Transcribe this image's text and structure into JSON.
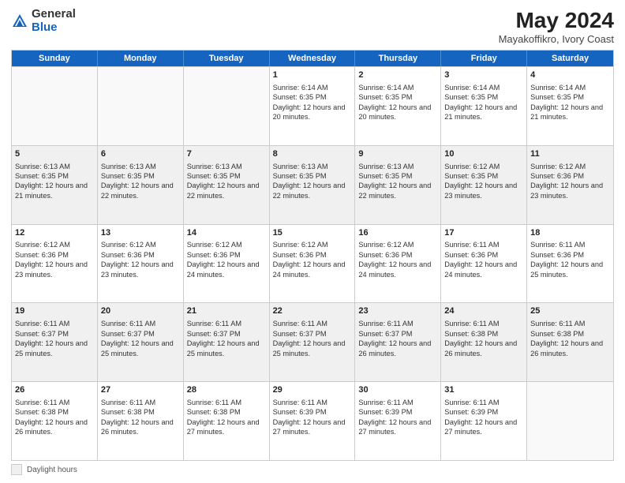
{
  "header": {
    "logo_general": "General",
    "logo_blue": "Blue",
    "month_year": "May 2024",
    "location": "Mayakoffikro, Ivory Coast"
  },
  "days_of_week": [
    "Sunday",
    "Monday",
    "Tuesday",
    "Wednesday",
    "Thursday",
    "Friday",
    "Saturday"
  ],
  "weeks": [
    [
      {
        "day": "",
        "info": "",
        "shaded": false,
        "empty": true
      },
      {
        "day": "",
        "info": "",
        "shaded": false,
        "empty": true
      },
      {
        "day": "",
        "info": "",
        "shaded": false,
        "empty": true
      },
      {
        "day": "1",
        "info": "Sunrise: 6:14 AM\nSunset: 6:35 PM\nDaylight: 12 hours and 20 minutes.",
        "shaded": false,
        "empty": false
      },
      {
        "day": "2",
        "info": "Sunrise: 6:14 AM\nSunset: 6:35 PM\nDaylight: 12 hours and 20 minutes.",
        "shaded": false,
        "empty": false
      },
      {
        "day": "3",
        "info": "Sunrise: 6:14 AM\nSunset: 6:35 PM\nDaylight: 12 hours and 21 minutes.",
        "shaded": false,
        "empty": false
      },
      {
        "day": "4",
        "info": "Sunrise: 6:14 AM\nSunset: 6:35 PM\nDaylight: 12 hours and 21 minutes.",
        "shaded": false,
        "empty": false
      }
    ],
    [
      {
        "day": "5",
        "info": "Sunrise: 6:13 AM\nSunset: 6:35 PM\nDaylight: 12 hours and 21 minutes.",
        "shaded": true,
        "empty": false
      },
      {
        "day": "6",
        "info": "Sunrise: 6:13 AM\nSunset: 6:35 PM\nDaylight: 12 hours and 22 minutes.",
        "shaded": true,
        "empty": false
      },
      {
        "day": "7",
        "info": "Sunrise: 6:13 AM\nSunset: 6:35 PM\nDaylight: 12 hours and 22 minutes.",
        "shaded": true,
        "empty": false
      },
      {
        "day": "8",
        "info": "Sunrise: 6:13 AM\nSunset: 6:35 PM\nDaylight: 12 hours and 22 minutes.",
        "shaded": true,
        "empty": false
      },
      {
        "day": "9",
        "info": "Sunrise: 6:13 AM\nSunset: 6:35 PM\nDaylight: 12 hours and 22 minutes.",
        "shaded": true,
        "empty": false
      },
      {
        "day": "10",
        "info": "Sunrise: 6:12 AM\nSunset: 6:35 PM\nDaylight: 12 hours and 23 minutes.",
        "shaded": true,
        "empty": false
      },
      {
        "day": "11",
        "info": "Sunrise: 6:12 AM\nSunset: 6:36 PM\nDaylight: 12 hours and 23 minutes.",
        "shaded": true,
        "empty": false
      }
    ],
    [
      {
        "day": "12",
        "info": "Sunrise: 6:12 AM\nSunset: 6:36 PM\nDaylight: 12 hours and 23 minutes.",
        "shaded": false,
        "empty": false
      },
      {
        "day": "13",
        "info": "Sunrise: 6:12 AM\nSunset: 6:36 PM\nDaylight: 12 hours and 23 minutes.",
        "shaded": false,
        "empty": false
      },
      {
        "day": "14",
        "info": "Sunrise: 6:12 AM\nSunset: 6:36 PM\nDaylight: 12 hours and 24 minutes.",
        "shaded": false,
        "empty": false
      },
      {
        "day": "15",
        "info": "Sunrise: 6:12 AM\nSunset: 6:36 PM\nDaylight: 12 hours and 24 minutes.",
        "shaded": false,
        "empty": false
      },
      {
        "day": "16",
        "info": "Sunrise: 6:12 AM\nSunset: 6:36 PM\nDaylight: 12 hours and 24 minutes.",
        "shaded": false,
        "empty": false
      },
      {
        "day": "17",
        "info": "Sunrise: 6:11 AM\nSunset: 6:36 PM\nDaylight: 12 hours and 24 minutes.",
        "shaded": false,
        "empty": false
      },
      {
        "day": "18",
        "info": "Sunrise: 6:11 AM\nSunset: 6:36 PM\nDaylight: 12 hours and 25 minutes.",
        "shaded": false,
        "empty": false
      }
    ],
    [
      {
        "day": "19",
        "info": "Sunrise: 6:11 AM\nSunset: 6:37 PM\nDaylight: 12 hours and 25 minutes.",
        "shaded": true,
        "empty": false
      },
      {
        "day": "20",
        "info": "Sunrise: 6:11 AM\nSunset: 6:37 PM\nDaylight: 12 hours and 25 minutes.",
        "shaded": true,
        "empty": false
      },
      {
        "day": "21",
        "info": "Sunrise: 6:11 AM\nSunset: 6:37 PM\nDaylight: 12 hours and 25 minutes.",
        "shaded": true,
        "empty": false
      },
      {
        "day": "22",
        "info": "Sunrise: 6:11 AM\nSunset: 6:37 PM\nDaylight: 12 hours and 25 minutes.",
        "shaded": true,
        "empty": false
      },
      {
        "day": "23",
        "info": "Sunrise: 6:11 AM\nSunset: 6:37 PM\nDaylight: 12 hours and 26 minutes.",
        "shaded": true,
        "empty": false
      },
      {
        "day": "24",
        "info": "Sunrise: 6:11 AM\nSunset: 6:38 PM\nDaylight: 12 hours and 26 minutes.",
        "shaded": true,
        "empty": false
      },
      {
        "day": "25",
        "info": "Sunrise: 6:11 AM\nSunset: 6:38 PM\nDaylight: 12 hours and 26 minutes.",
        "shaded": true,
        "empty": false
      }
    ],
    [
      {
        "day": "26",
        "info": "Sunrise: 6:11 AM\nSunset: 6:38 PM\nDaylight: 12 hours and 26 minutes.",
        "shaded": false,
        "empty": false
      },
      {
        "day": "27",
        "info": "Sunrise: 6:11 AM\nSunset: 6:38 PM\nDaylight: 12 hours and 26 minutes.",
        "shaded": false,
        "empty": false
      },
      {
        "day": "28",
        "info": "Sunrise: 6:11 AM\nSunset: 6:38 PM\nDaylight: 12 hours and 27 minutes.",
        "shaded": false,
        "empty": false
      },
      {
        "day": "29",
        "info": "Sunrise: 6:11 AM\nSunset: 6:39 PM\nDaylight: 12 hours and 27 minutes.",
        "shaded": false,
        "empty": false
      },
      {
        "day": "30",
        "info": "Sunrise: 6:11 AM\nSunset: 6:39 PM\nDaylight: 12 hours and 27 minutes.",
        "shaded": false,
        "empty": false
      },
      {
        "day": "31",
        "info": "Sunrise: 6:11 AM\nSunset: 6:39 PM\nDaylight: 12 hours and 27 minutes.",
        "shaded": false,
        "empty": false
      },
      {
        "day": "",
        "info": "",
        "shaded": false,
        "empty": true
      }
    ]
  ],
  "footer": {
    "label": "Daylight hours"
  }
}
